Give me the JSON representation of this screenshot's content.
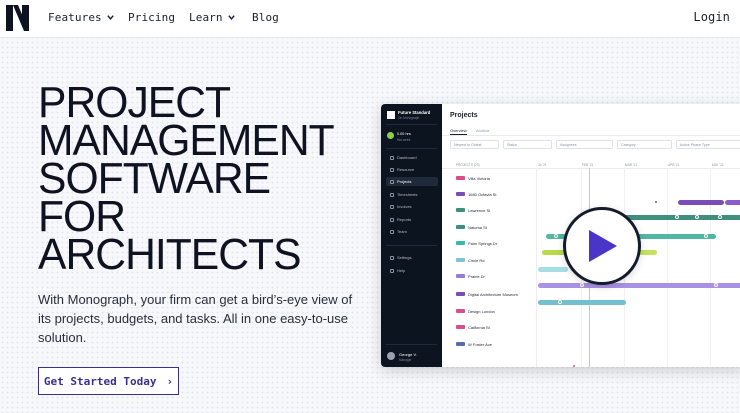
{
  "nav": {
    "items": [
      {
        "label": "Features",
        "has_dropdown": true
      },
      {
        "label": "Pricing",
        "has_dropdown": false
      },
      {
        "label": "Learn",
        "has_dropdown": true
      },
      {
        "label": "Blog",
        "has_dropdown": false
      }
    ],
    "login": "Login"
  },
  "hero": {
    "title_lines": [
      "PROJECT",
      "MANAGEMENT",
      "SOFTWARE",
      "FOR",
      "ARCHITECTS"
    ],
    "description": "With Monograph, your firm can get a bird’s-eye view of its projects, budgets, and tasks. All in one easy-to-use solution.",
    "cta_label": "Get Started Today",
    "cta_arrow": "›"
  },
  "app": {
    "workspace": {
      "name": "Future Standard",
      "subtitle": "On Monograph"
    },
    "usage": {
      "primary": "0.00 hrs",
      "secondary": "this week"
    },
    "sidebar": [
      {
        "label": "Dashboard",
        "active": false
      },
      {
        "label": "Resource",
        "active": false
      },
      {
        "label": "Projects",
        "active": true
      },
      {
        "label": "Timesheets",
        "active": false
      },
      {
        "label": "Invoices",
        "active": false
      },
      {
        "label": "Reports",
        "active": false
      },
      {
        "label": "Team",
        "active": false
      },
      {
        "label": "Settings",
        "active": false
      },
      {
        "label": "Help",
        "active": false
      }
    ],
    "user": {
      "name": "George V.",
      "role": "Manager"
    },
    "main": {
      "title": "Projects",
      "tabs": [
        {
          "label": "Overview",
          "active": true
        },
        {
          "label": "Archive",
          "active": false
        }
      ],
      "filters": [
        "Newest to Oldest",
        "Status",
        "Assignees",
        "Category",
        "Active Phase Type"
      ],
      "column_header": "PROJECTS (23)",
      "months": [
        "JA '21",
        "FEB '21",
        "MAR '21",
        "APR '21",
        "MAY '21"
      ],
      "projects": [
        {
          "name": "Villa Victoria",
          "color": "#d94f8a"
        },
        {
          "name": "1680 Octavia St",
          "color": "#7b4bb8"
        },
        {
          "name": "Lawrence St",
          "color": "#3f8f7f"
        },
        {
          "name": "Natoma St",
          "color": "#3f8f7f"
        },
        {
          "name": "Palm Springs Dr",
          "color": "#39b7a8"
        },
        {
          "name": "Circle Rd",
          "color": "#7fc3d4"
        },
        {
          "name": "Prairie Dr",
          "color": "#9b7ad8"
        },
        {
          "name": "Digital Architecture Museum",
          "color": "#7b4bb8"
        },
        {
          "name": "Design London",
          "color": "#d94f8a"
        },
        {
          "name": "California St",
          "color": "#d94f8a"
        },
        {
          "name": "W Foster Ave",
          "color": "#5a6ea8"
        }
      ]
    }
  },
  "video": {
    "icon": "play-icon"
  },
  "colors": {
    "accent": "#3b2f8f",
    "play": "#4a35c9",
    "sidebar_bg": "#0c1420"
  }
}
